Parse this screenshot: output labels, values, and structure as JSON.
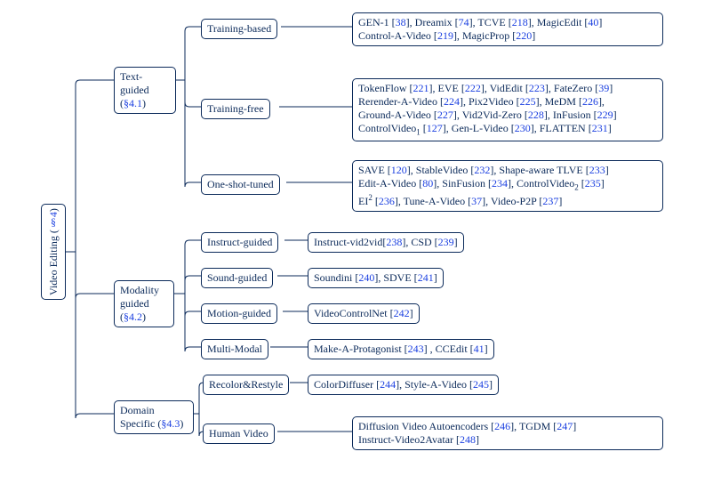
{
  "root": {
    "label": "Video Editing (",
    "section": "§4",
    "tail": ")"
  },
  "cat_text": {
    "label": "Text-guided (",
    "section": "§4.1",
    "tail": ")"
  },
  "cat_modality": {
    "label": "Modality guided (",
    "section": "§4.2",
    "tail": ")"
  },
  "cat_domain": {
    "label": "Domain Specific (",
    "section": "§4.3",
    "tail": ")"
  },
  "sub": {
    "training_based": "Training-based",
    "training_free": "Training-free",
    "one_shot": "One-shot-tuned",
    "instruct": "Instruct-guided",
    "sound": "Sound-guided",
    "motion": "Motion-guided",
    "multi": "Multi-Modal",
    "recolor": "Recolor&Restyle",
    "human": "Human Video"
  },
  "leaf_training_based": [
    {
      "t": "GEN-1 [",
      "c": "38",
      "e": "], "
    },
    {
      "t": "Dreamix [",
      "c": "74",
      "e": "], "
    },
    {
      "t": "TCVE [",
      "c": "218",
      "e": "], "
    },
    {
      "t": "MagicEdit [",
      "c": "40",
      "e": "]"
    },
    {
      "br": true
    },
    {
      "t": "Control-A-Video [",
      "c": "219",
      "e": "], "
    },
    {
      "t": "MagicProp [",
      "c": "220",
      "e": "]"
    }
  ],
  "leaf_training_free": [
    {
      "t": "TokenFlow [",
      "c": "221",
      "e": "], "
    },
    {
      "t": "EVE [",
      "c": "222",
      "e": "], "
    },
    {
      "t": "VidEdit [",
      "c": "223",
      "e": "], "
    },
    {
      "t": "FateZero [",
      "c": "39",
      "e": "]"
    },
    {
      "br": true
    },
    {
      "t": "Rerender-A-Video [",
      "c": "224",
      "e": "], "
    },
    {
      "t": "Pix2Video [",
      "c": "225",
      "e": "], "
    },
    {
      "t": "MeDM [",
      "c": "226",
      "e": "], "
    },
    {
      "br": true
    },
    {
      "t": "Ground-A-Video [",
      "c": "227",
      "e": "], "
    },
    {
      "t": "Vid2Vid-Zero [",
      "c": "228",
      "e": "], "
    },
    {
      "t": "InFusion [",
      "c": "229",
      "e": "]"
    },
    {
      "br": true
    },
    {
      "t": "ControlVideo",
      "sub": "1",
      "after": " [",
      "c": "127",
      "e": "], "
    },
    {
      "t": "Gen-L-Video [",
      "c": "230",
      "e": "], "
    },
    {
      "t": "FLATTEN [",
      "c": "231",
      "e": "]"
    }
  ],
  "leaf_one_shot": [
    {
      "t": "SAVE [",
      "c": "120",
      "e": "], "
    },
    {
      "t": "StableVideo [",
      "c": "232",
      "e": "], "
    },
    {
      "t": "Shape-aware TLVE [",
      "c": "233",
      "e": "]"
    },
    {
      "br": true
    },
    {
      "t": "Edit-A-Video [",
      "c": "80",
      "e": "], "
    },
    {
      "t": "SinFusion [",
      "c": "234",
      "e": "], "
    },
    {
      "t": "ControlVideo",
      "sub": "2",
      "after": " [",
      "c": "235",
      "e": "]"
    },
    {
      "br": true
    },
    {
      "t": "EI",
      "sup": "2",
      "after": " [",
      "c": "236",
      "e": "], "
    },
    {
      "t": "Tune-A-Video [",
      "c": "37",
      "e": "], "
    },
    {
      "t": "Video-P2P [",
      "c": "237",
      "e": "]"
    }
  ],
  "leaf_instruct": [
    {
      "t": "Instruct-vid2vid[",
      "c": "238",
      "e": "], "
    },
    {
      "t": "CSD [",
      "c": "239",
      "e": "]"
    }
  ],
  "leaf_sound": [
    {
      "t": "Soundini [",
      "c": "240",
      "e": "], "
    },
    {
      "t": "SDVE [",
      "c": "241",
      "e": "]"
    }
  ],
  "leaf_motion": [
    {
      "t": "VideoControlNet [",
      "c": "242",
      "e": "]"
    }
  ],
  "leaf_multi": [
    {
      "t": "Make-A-Protagonist [",
      "c": "243",
      "e": "] , "
    },
    {
      "t": "CCEdit [",
      "c": "41",
      "e": "]"
    }
  ],
  "leaf_recolor": [
    {
      "t": "ColorDiffuser [",
      "c": "244",
      "e": "], "
    },
    {
      "t": "Style-A-Video [",
      "c": "245",
      "e": "]"
    }
  ],
  "leaf_human": [
    {
      "t": "Diffusion Video Autoencoders [",
      "c": "246",
      "e": "], "
    },
    {
      "t": "TGDM [",
      "c": "247",
      "e": "]"
    },
    {
      "br": true
    },
    {
      "t": "Instruct-Video2Avatar [",
      "c": "248",
      "e": "]"
    }
  ]
}
